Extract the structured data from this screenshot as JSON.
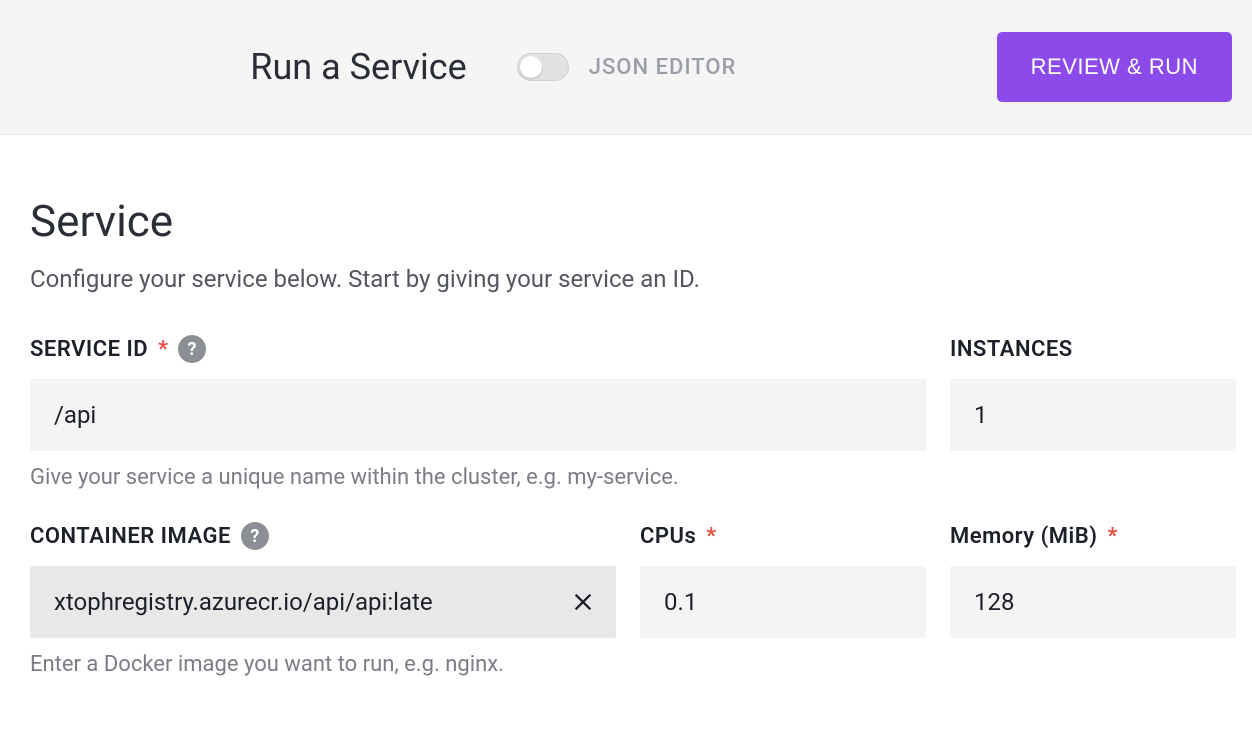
{
  "header": {
    "title": "Run a Service",
    "toggle_label": "JSON EDITOR",
    "review_button": "REVIEW & RUN"
  },
  "service": {
    "heading": "Service",
    "description": "Configure your service below. Start by giving your service an ID.",
    "service_id": {
      "label": "SERVICE ID",
      "value": "/api",
      "hint": "Give your service a unique name within the cluster, e.g. my-service."
    },
    "instances": {
      "label": "INSTANCES",
      "value": "1"
    },
    "container_image": {
      "label": "CONTAINER IMAGE",
      "value": "xtophregistry.azurecr.io/api/api:late",
      "hint": "Enter a Docker image you want to run, e.g. nginx."
    },
    "cpus": {
      "label": "CPUs",
      "value": "0.1"
    },
    "memory": {
      "label": "Memory (MiB)",
      "value": "128"
    }
  }
}
